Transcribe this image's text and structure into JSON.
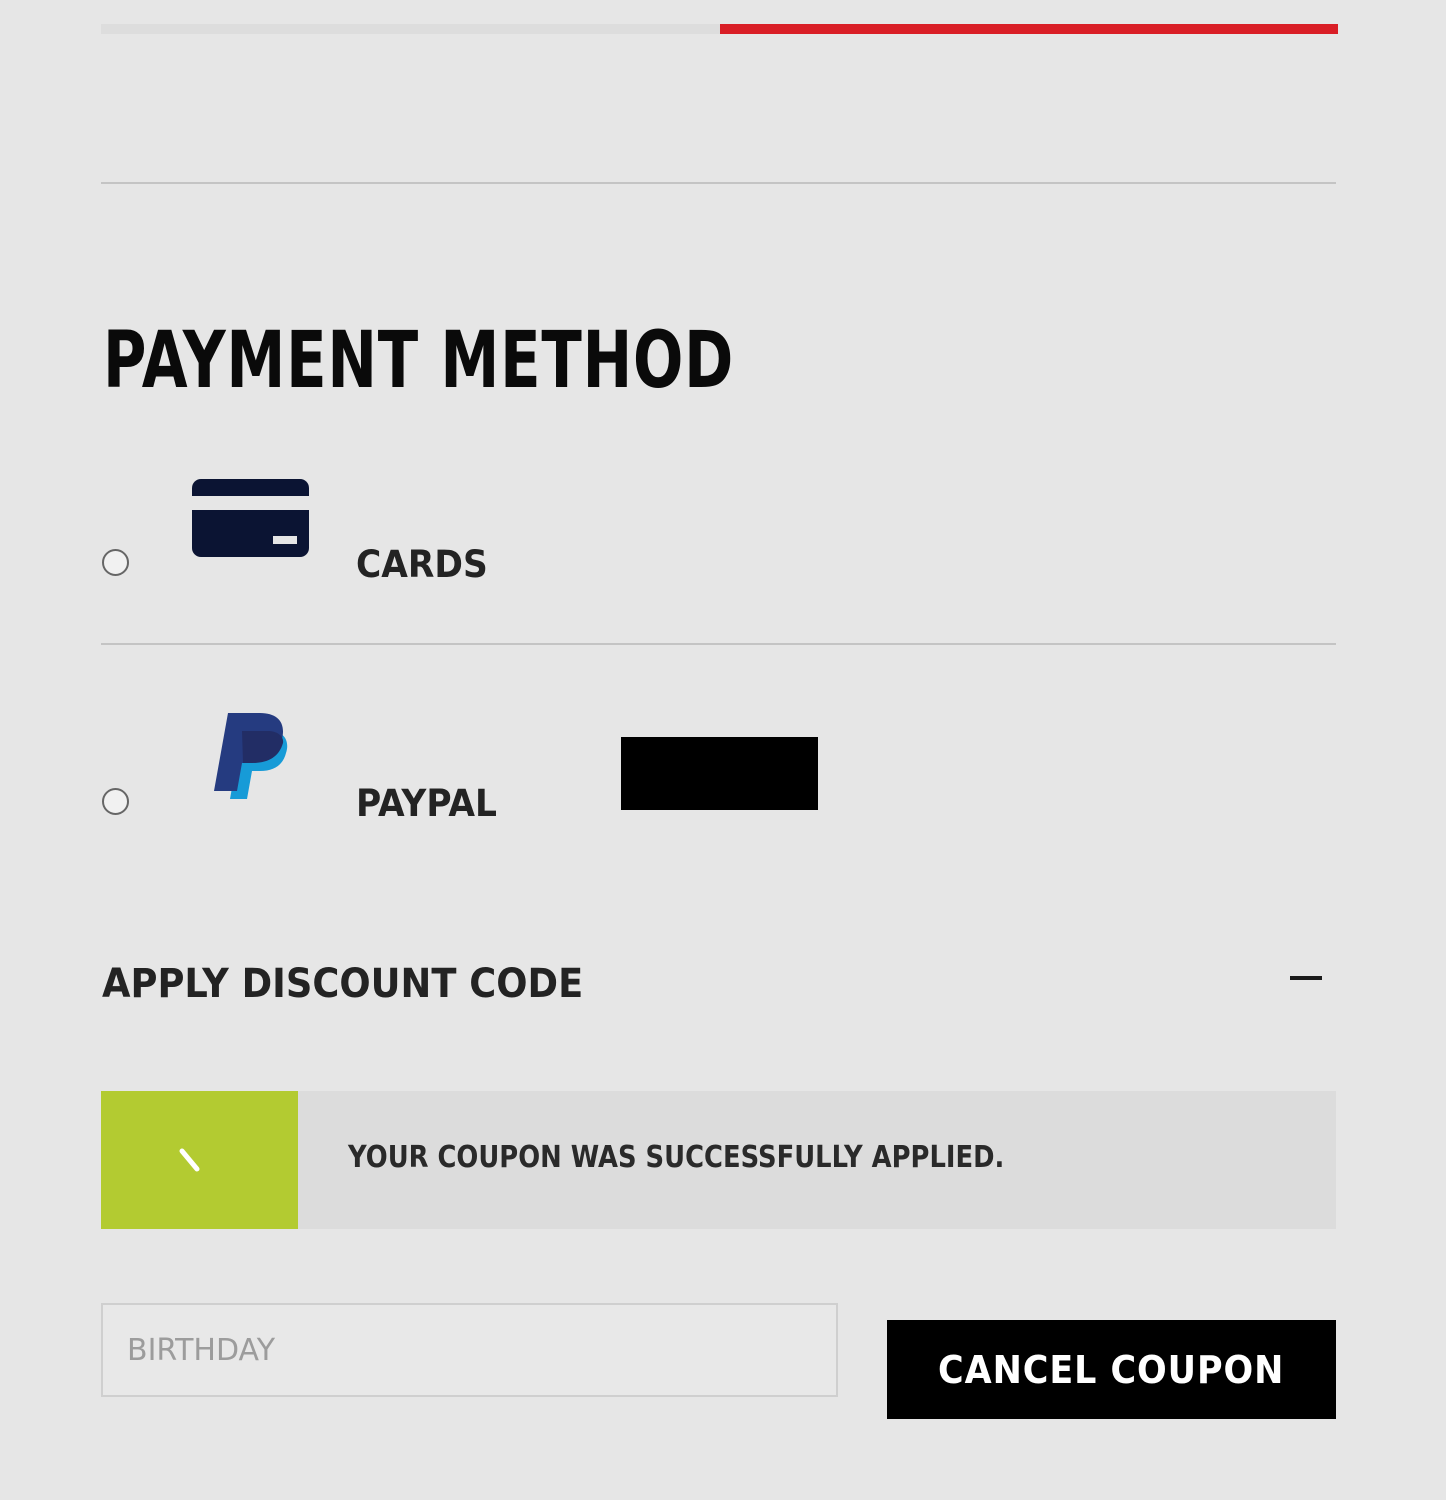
{
  "progress": {
    "fraction_complete": 0.5,
    "colors": {
      "track": "#dddddd",
      "fill": "#d91e26"
    }
  },
  "payment": {
    "title": "PAYMENT METHOD",
    "methods": [
      {
        "label": "CARDS",
        "icon": "credit-card-icon",
        "selected": false
      },
      {
        "label": "PAYPAL",
        "icon": "paypal-icon",
        "selected": false
      }
    ]
  },
  "discount": {
    "heading": "APPLY DISCOUNT CODE",
    "toggle_icon": "minus-icon",
    "alert": {
      "message": "YOUR COUPON WAS SUCCESSFULLY APPLIED.",
      "icon": "check-icon",
      "accent_color": "#b3cb31"
    },
    "input": {
      "value": "",
      "placeholder": "BIRTHDAY"
    },
    "cancel_label": "CANCEL COUPON"
  },
  "colors": {
    "background": "#e6e6e6",
    "card_icon": "#0b1433",
    "paypal_dark": "#253b80",
    "paypal_light": "#179bd7",
    "button": "#000000"
  }
}
